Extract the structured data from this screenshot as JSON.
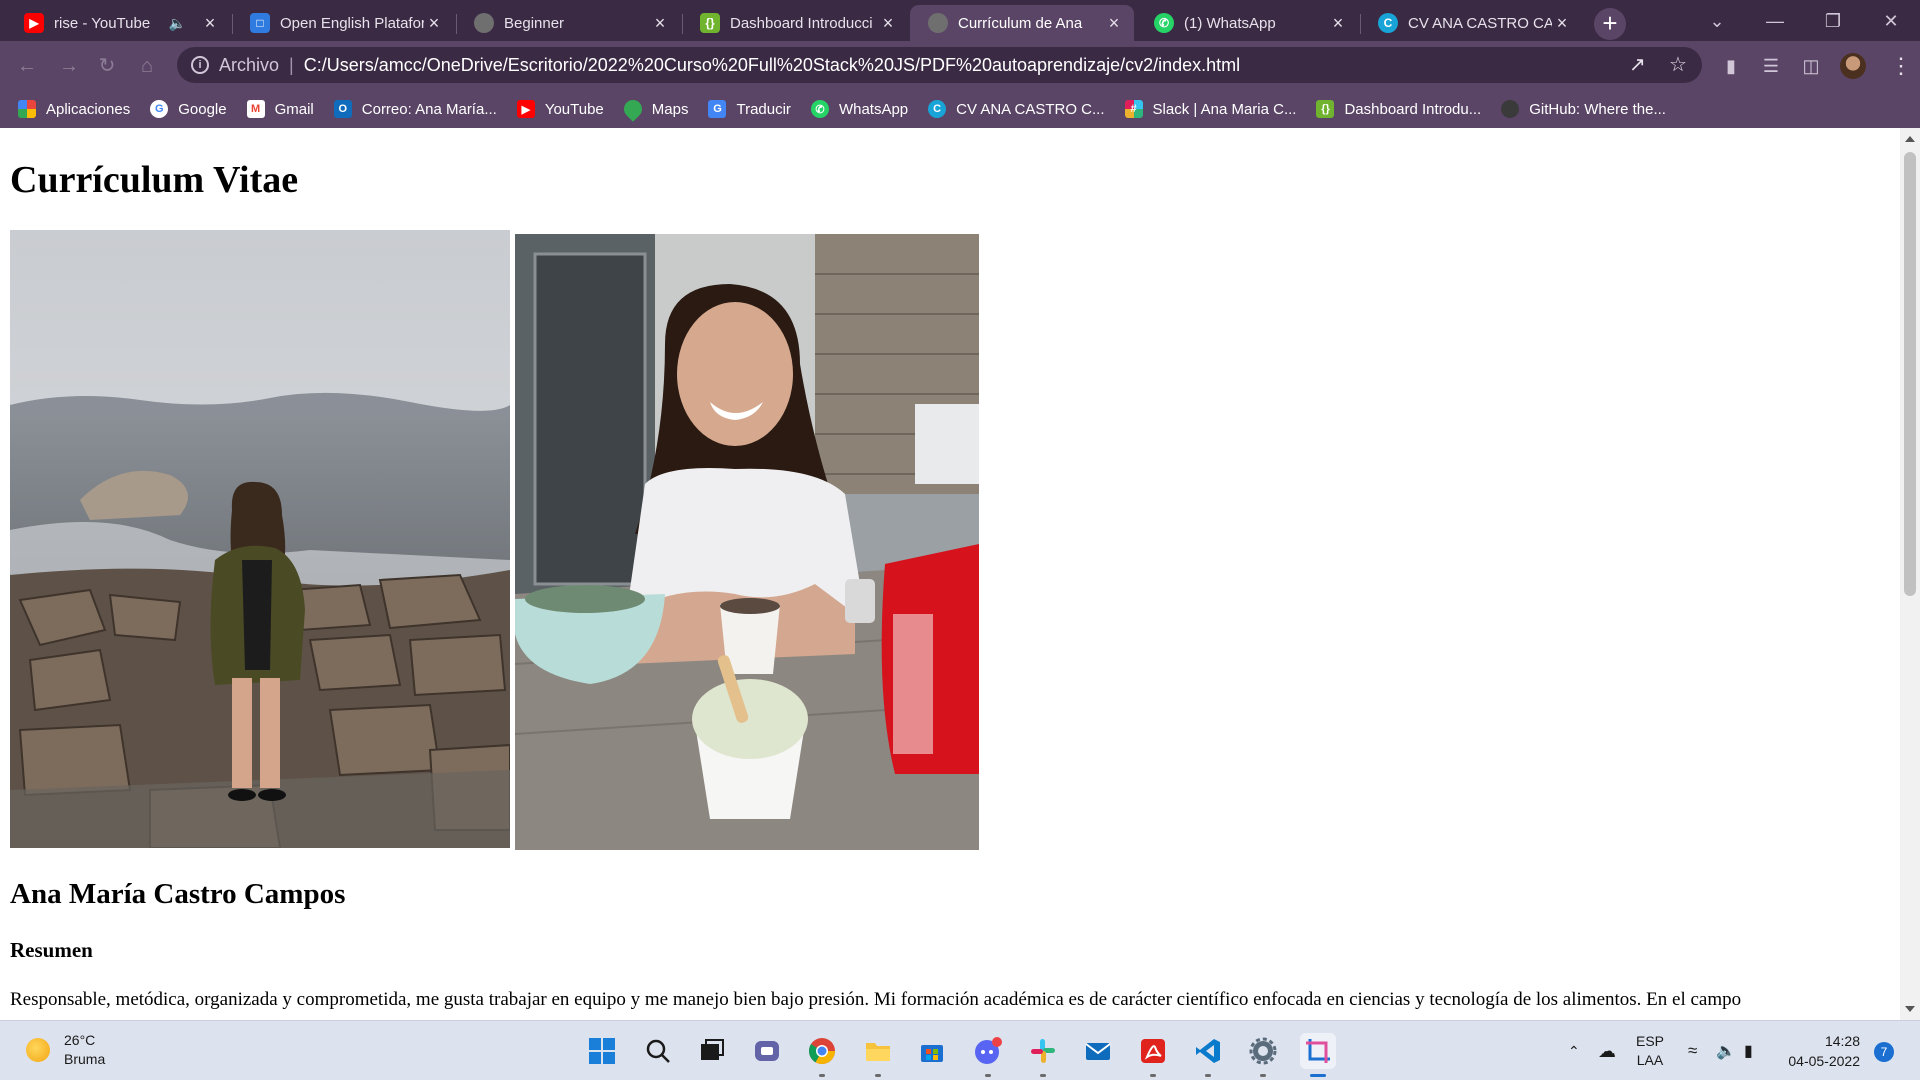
{
  "browser": {
    "tabs": [
      {
        "title": "rise - YouTube",
        "icon": "youtube-icon",
        "color": "#ff0000",
        "muted": true
      },
      {
        "title": "Open English Platafor",
        "icon": "open-english-icon",
        "color": "#2f7be0"
      },
      {
        "title": "Beginner",
        "icon": "globe-icon",
        "color": "#6f6f6f"
      },
      {
        "title": "Dashboard Introducci",
        "icon": "dashboard-icon",
        "color": "#6fb32e"
      },
      {
        "title": "Currículum de Ana",
        "icon": "globe-icon",
        "color": "#6f6f6f",
        "active": true
      },
      {
        "title": "(1) WhatsApp",
        "icon": "whatsapp-icon",
        "color": "#25d366"
      },
      {
        "title": "CV ANA CASTRO CAM",
        "icon": "canva-icon",
        "color": "#18a4d6"
      }
    ],
    "new_tab_label": "+",
    "address": {
      "scheme_label": "Archivo",
      "url": "C:/Users/amcc/OneDrive/Escritorio/2022%20Curso%20Full%20Stack%20JS/PDF%20autoaprendizaje/cv2/index.html"
    },
    "bookmarks": [
      {
        "label": "Aplicaciones",
        "icon": "apps-grid-icon",
        "color": "#e8453c"
      },
      {
        "label": "Google",
        "icon": "google-icon",
        "color": "#4285f4"
      },
      {
        "label": "Gmail",
        "icon": "gmail-icon",
        "color": "#ea4335"
      },
      {
        "label": "Correo: Ana María...",
        "icon": "outlook-icon",
        "color": "#0f6cbd"
      },
      {
        "label": "YouTube",
        "icon": "youtube-icon",
        "color": "#ff0000"
      },
      {
        "label": "Maps",
        "icon": "maps-icon",
        "color": "#34a853"
      },
      {
        "label": "Traducir",
        "icon": "translate-icon",
        "color": "#4285f4"
      },
      {
        "label": "WhatsApp",
        "icon": "whatsapp-icon",
        "color": "#25d366"
      },
      {
        "label": "CV ANA CASTRO C...",
        "icon": "canva-icon",
        "color": "#18a4d6"
      },
      {
        "label": "Slack | Ana Maria C...",
        "icon": "slack-icon",
        "color": "#e01e5a"
      },
      {
        "label": "Dashboard Introdu...",
        "icon": "dashboard-icon",
        "color": "#6fb32e"
      },
      {
        "label": "GitHub: Where the...",
        "icon": "github-icon",
        "color": "#3a3a3a"
      }
    ]
  },
  "page": {
    "title": "Currículum Vitae",
    "name": "Ana María Castro Campos",
    "summary_heading": "Resumen",
    "summary_text": "Responsable, metódica, organizada y comprometida, me gusta trabajar en equipo y me manejo bien bajo presión. Mi formación académica es de carácter científico enfocada en ciencias y tecnología de los alimentos. En el campo"
  },
  "taskbar": {
    "weather": {
      "temp": "26°C",
      "condition": "Bruma"
    },
    "apps": [
      {
        "name": "start-button",
        "icon": "windows-icon"
      },
      {
        "name": "search-button",
        "icon": "search-icon"
      },
      {
        "name": "task-view-button",
        "icon": "task-view-icon"
      },
      {
        "name": "teams-chat-button",
        "icon": "teams-icon"
      },
      {
        "name": "chrome-app",
        "icon": "chrome-icon",
        "open": true
      },
      {
        "name": "file-explorer-app",
        "icon": "folder-icon",
        "open": true
      },
      {
        "name": "microsoft-store-app",
        "icon": "store-icon"
      },
      {
        "name": "discord-app",
        "icon": "discord-icon",
        "open": true
      },
      {
        "name": "slack-app",
        "icon": "slack-icon",
        "open": true
      },
      {
        "name": "mail-app",
        "icon": "mail-icon"
      },
      {
        "name": "acrobat-app",
        "icon": "acrobat-icon",
        "open": true
      },
      {
        "name": "vscode-app",
        "icon": "vscode-icon",
        "open": true
      },
      {
        "name": "settings-app",
        "icon": "gear-icon",
        "open": true
      },
      {
        "name": "snipping-tool-app",
        "icon": "snipping-icon",
        "active": true
      }
    ],
    "language": {
      "line1": "ESP",
      "line2": "LAA"
    },
    "clock": {
      "time": "14:28",
      "date": "04-05-2022"
    },
    "notifications": "7"
  }
}
